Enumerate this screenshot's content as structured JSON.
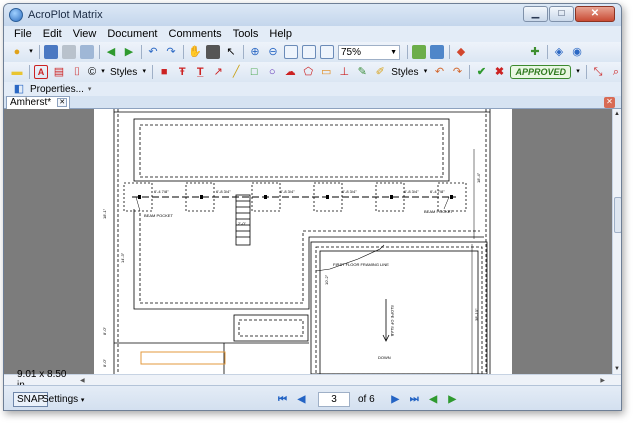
{
  "window": {
    "title": "AcroPlot Matrix",
    "minimize_glyph": "▁",
    "maximize_glyph": "□",
    "close_glyph": "✕"
  },
  "menu": [
    "File",
    "Edit",
    "View",
    "Document",
    "Comments",
    "Tools",
    "Help"
  ],
  "toolbar1": {
    "zoom_value": "75%"
  },
  "toolbar2": {
    "styles_label_1": "Styles",
    "styles_label_2": "Styles",
    "stamp_label": "APPROVED"
  },
  "properties_label": "Properties...",
  "tab": {
    "name": "Amherst*",
    "close_glyph": "✕"
  },
  "drawing": {
    "dimensions": [
      "6'-4 7/8\"",
      "6'-8 3/4\"",
      "6'-8 3/4\"",
      "6'-8 3/4\"",
      "6'-8 3/4\"",
      "6'-4 7/8\""
    ],
    "stair_label": "2'-0\"",
    "note_first_floor": "FIRST FLOOR FRAMING LINE",
    "slope_label": "SLOPE OF SLAB",
    "down_label": "DOWN",
    "beam_pocket_left": "BEAM POCKET",
    "beam_pocket_right": "BEAM POCKET",
    "vertical_dims": [
      "18'-1\"",
      "18'-4\"",
      "14'-3\"",
      "10'-2\"",
      "38'-10\"",
      "8'-0\"",
      "8'-0\""
    ]
  },
  "status": {
    "page_size": "9.01 x 8.50 in",
    "snap": "SNAP",
    "settings": "Settings",
    "current_page": "3",
    "page_of": "of 6"
  },
  "colors": {
    "titlebar": "#c4d6ec",
    "viewer_bg": "#7c7c7c",
    "nav_blue": "#2464c4",
    "approved_green": "#2f7a1f",
    "close_red": "#c94b34"
  }
}
